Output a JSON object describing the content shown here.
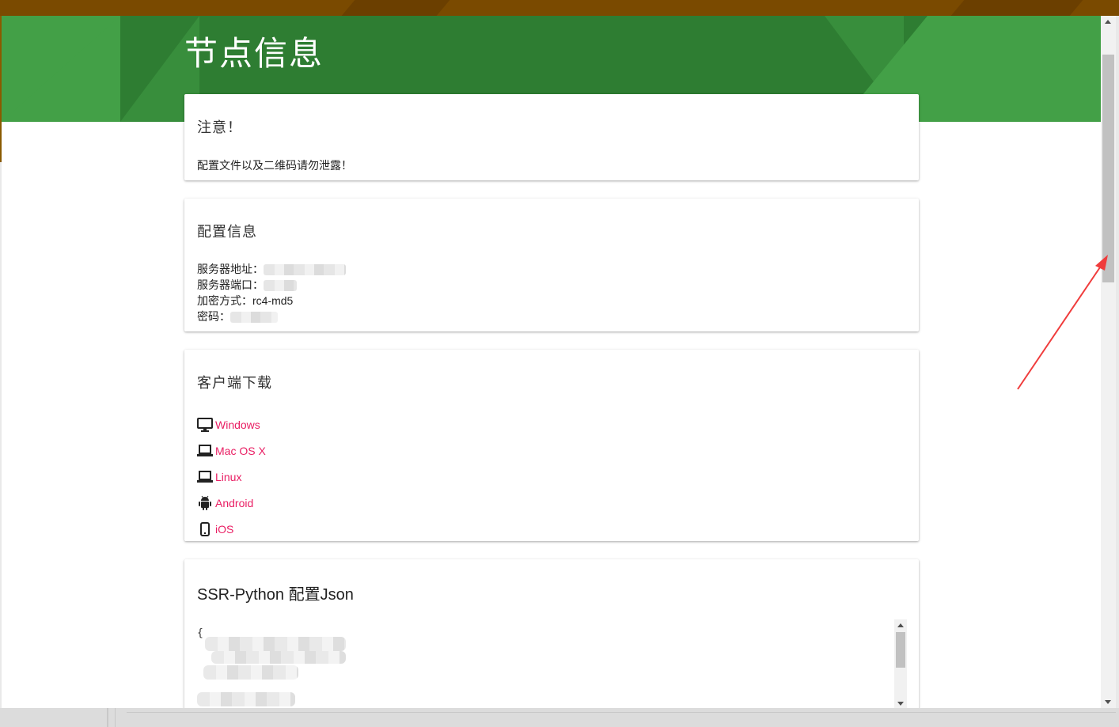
{
  "header": {
    "title": "节点信息"
  },
  "notice": {
    "title": "注意！",
    "text": "配置文件以及二维码请勿泄露！"
  },
  "config": {
    "title": "配置信息",
    "server_label": "服务器地址：",
    "port_label": "服务器端口：",
    "method_label": "加密方式：",
    "method_value": "rc4-md5",
    "password_label": "密码："
  },
  "clients": {
    "title": "客户端下载",
    "items": [
      {
        "label": "Windows",
        "icon": "desktop-icon"
      },
      {
        "label": "Mac OS X",
        "icon": "laptop-icon"
      },
      {
        "label": "Linux",
        "icon": "laptop-icon"
      },
      {
        "label": "Android",
        "icon": "android-icon"
      },
      {
        "label": "iOS",
        "icon": "mobile-icon"
      }
    ]
  },
  "json_config": {
    "title": "SSR-Python 配置Json",
    "open_brace": "{"
  },
  "colors": {
    "header_green": "#2e7d32",
    "link_pink": "#e91e63",
    "annotation_red": "#f03c3c"
  }
}
